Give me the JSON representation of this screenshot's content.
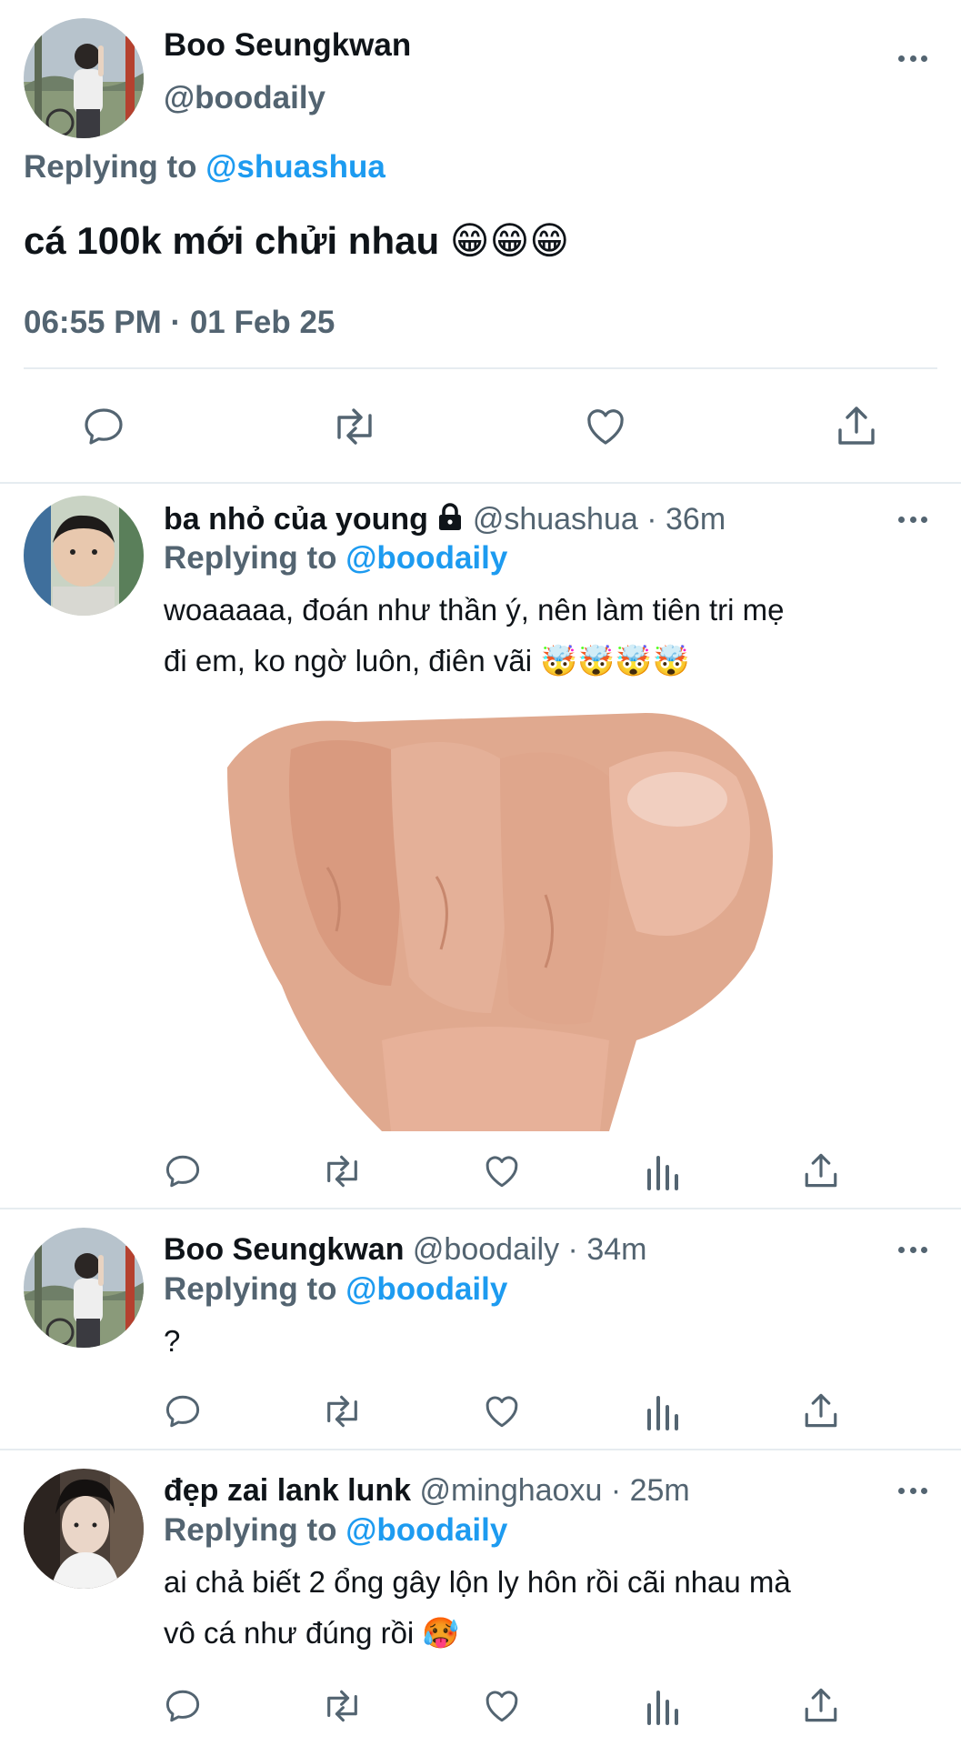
{
  "main_tweet": {
    "display_name": "Boo Seungkwan",
    "handle": "@boodaily",
    "replying_prefix": "Replying to",
    "replying_to": "@shuashua",
    "text": "cá 100k mới chửi nhau 😁😁😁",
    "timestamp": "06:55 PM · 01 Feb 25"
  },
  "replies": [
    {
      "display_name": "ba nhỏ của young",
      "handle": "@shuashua",
      "time": "· 36m",
      "replying_prefix": "Replying to",
      "replying_to": "@boodaily",
      "text_line1": "woaaaaa, đoán như thần ý, nên làm tiên tri mẹ",
      "text_line2": "đi em, ko ngờ luôn, điên vãi 🤯🤯🤯🤯",
      "has_media": true,
      "media_description": "hand pointing at viewer"
    },
    {
      "display_name": "Boo Seungkwan",
      "handle": "@boodaily",
      "time": "· 34m",
      "replying_prefix": "Replying to",
      "replying_to": "@boodaily",
      "text_line1": "?"
    },
    {
      "display_name": "đẹp zai lank lunk",
      "handle": "@minghaoxu",
      "time": "· 25m",
      "replying_prefix": "Replying to",
      "replying_to": "@boodaily",
      "text_line1": "ai chả biết 2 ổng gây lộn ly hôn rồi cãi nhau mà",
      "text_line2": "vô cá như đúng rồi 🥵"
    }
  ],
  "icons": {
    "reply": "reply-icon",
    "retweet": "retweet-icon",
    "like": "like-icon",
    "views": "views-icon",
    "share": "share-icon",
    "more": "more-icon",
    "lock": "lock-icon"
  },
  "colors": {
    "accent": "#1d9bf0",
    "text": "#0f1419",
    "secondary": "#536471",
    "divider": "#e6ecf0"
  }
}
